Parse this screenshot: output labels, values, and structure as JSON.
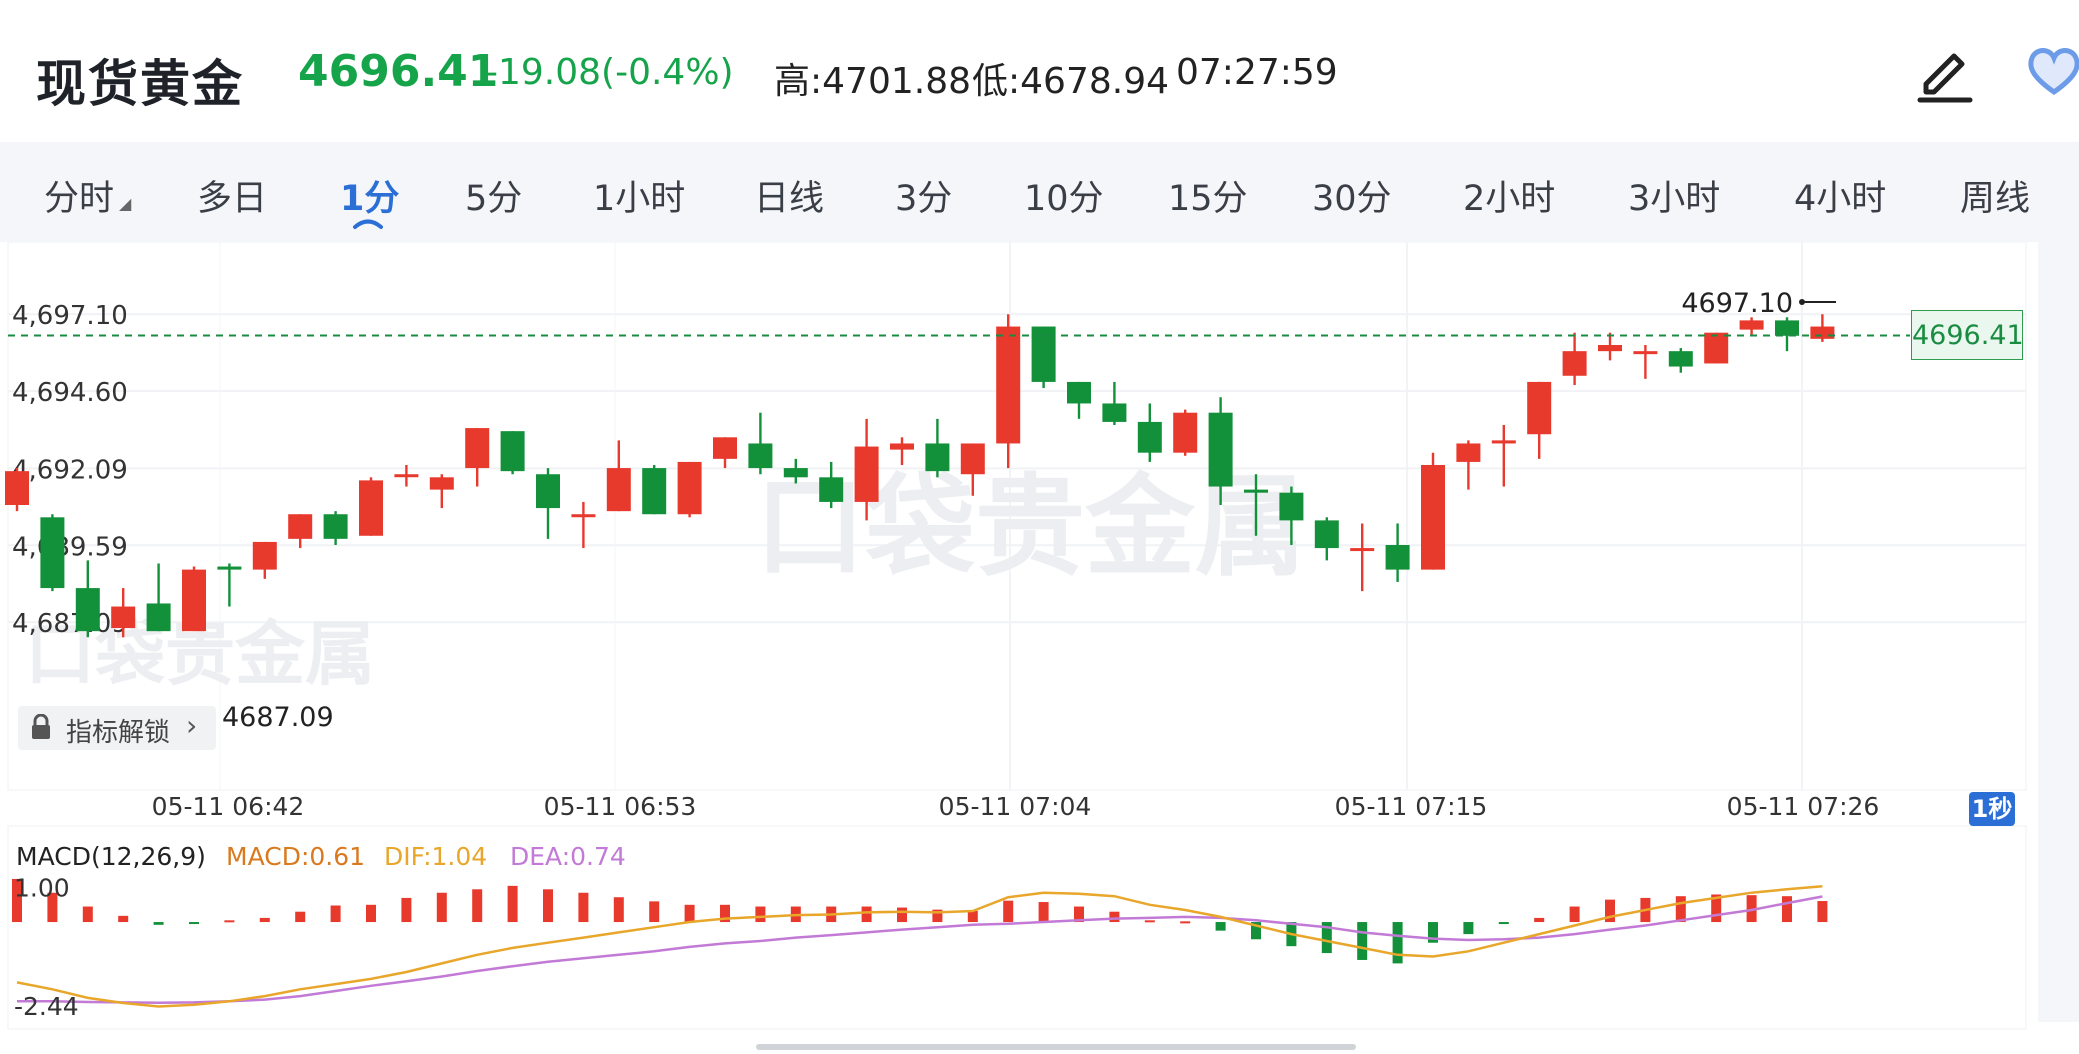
{
  "header": {
    "title": "现货黄金",
    "price": "4696.41",
    "change": "-19.08(-0.4%)",
    "high": "高:4701.88",
    "low": "低:4678.94",
    "time": "07:27:59"
  },
  "tabs": [
    "分时",
    "多日",
    "1分",
    "5分",
    "1小时",
    "日线",
    "3分",
    "10分",
    "15分",
    "30分",
    "2小时",
    "3小时",
    "4小时",
    "周线"
  ],
  "active_tab": "1分",
  "unlock_label": "指标解锁",
  "last_price_tag": "4696.41",
  "interval_badge": "1秒",
  "watermark": "口袋贵金属",
  "colors": {
    "up": "#e8392d",
    "down": "#13913a",
    "dif": "#e8a62a",
    "dea": "#c27ad6",
    "macd_label": "#d97a1e",
    "accent": "#2b6fd6"
  },
  "icons": {
    "edit": "pencil-icon",
    "favorite": "heart-icon",
    "lock": "lock-icon",
    "chevron": "chevron-right-icon"
  },
  "chart_data": {
    "type": "candlestick",
    "price_axis": {
      "ticks": [
        "4,697.10",
        "4,694.60",
        "4,692.09",
        "4,689.59",
        "4,687.09"
      ],
      "ylim": [
        4685.7,
        4698.7
      ]
    },
    "time_axis": [
      "05-11 06:42",
      "05-11 06:53",
      "05-11 07:04",
      "05-11 07:15",
      "05-11 07:26"
    ],
    "last_price": 4696.41,
    "max_label": "4697.10",
    "min_label": "4687.09",
    "candles": [
      {
        "o": 4690.9,
        "h": 4692.1,
        "l": 4690.7,
        "c": 4692.0
      },
      {
        "o": 4690.5,
        "h": 4690.6,
        "l": 4688.1,
        "c": 4688.2
      },
      {
        "o": 4688.2,
        "h": 4689.1,
        "l": 4686.6,
        "c": 4686.8
      },
      {
        "o": 4686.9,
        "h": 4688.2,
        "l": 4686.6,
        "c": 4687.6
      },
      {
        "o": 4687.7,
        "h": 4689.0,
        "l": 4686.8,
        "c": 4686.8
      },
      {
        "o": 4686.8,
        "h": 4688.9,
        "l": 4686.8,
        "c": 4688.8
      },
      {
        "o": 4688.9,
        "h": 4689.0,
        "l": 4687.6,
        "c": 4688.8
      },
      {
        "o": 4688.8,
        "h": 4689.7,
        "l": 4688.5,
        "c": 4689.7
      },
      {
        "o": 4689.8,
        "h": 4690.6,
        "l": 4689.5,
        "c": 4690.6
      },
      {
        "o": 4690.6,
        "h": 4690.7,
        "l": 4689.6,
        "c": 4689.8
      },
      {
        "o": 4689.9,
        "h": 4691.8,
        "l": 4689.9,
        "c": 4691.7
      },
      {
        "o": 4691.9,
        "h": 4692.2,
        "l": 4691.5,
        "c": 4691.9
      },
      {
        "o": 4691.4,
        "h": 4691.9,
        "l": 4690.8,
        "c": 4691.8
      },
      {
        "o": 4692.1,
        "h": 4693.4,
        "l": 4691.5,
        "c": 4693.4
      },
      {
        "o": 4693.3,
        "h": 4693.3,
        "l": 4691.9,
        "c": 4692.0
      },
      {
        "o": 4691.9,
        "h": 4692.1,
        "l": 4689.8,
        "c": 4690.8
      },
      {
        "o": 4690.6,
        "h": 4691.0,
        "l": 4689.5,
        "c": 4690.6
      },
      {
        "o": 4690.7,
        "h": 4693.0,
        "l": 4690.7,
        "c": 4692.1
      },
      {
        "o": 4692.1,
        "h": 4692.2,
        "l": 4690.6,
        "c": 4690.6
      },
      {
        "o": 4690.6,
        "h": 4692.3,
        "l": 4690.5,
        "c": 4692.3
      },
      {
        "o": 4692.4,
        "h": 4693.1,
        "l": 4692.1,
        "c": 4693.1
      },
      {
        "o": 4692.9,
        "h": 4693.9,
        "l": 4691.9,
        "c": 4692.1
      },
      {
        "o": 4692.1,
        "h": 4692.4,
        "l": 4691.6,
        "c": 4691.8
      },
      {
        "o": 4691.8,
        "h": 4692.3,
        "l": 4690.8,
        "c": 4691.0
      },
      {
        "o": 4691.0,
        "h": 4693.7,
        "l": 4690.4,
        "c": 4692.8
      },
      {
        "o": 4692.7,
        "h": 4693.1,
        "l": 4692.2,
        "c": 4692.9
      },
      {
        "o": 4692.9,
        "h": 4693.7,
        "l": 4691.8,
        "c": 4692.0
      },
      {
        "o": 4691.9,
        "h": 4692.9,
        "l": 4691.2,
        "c": 4692.9
      },
      {
        "o": 4692.9,
        "h": 4697.1,
        "l": 4692.1,
        "c": 4696.7
      },
      {
        "o": 4696.7,
        "h": 4696.7,
        "l": 4694.7,
        "c": 4694.9
      },
      {
        "o": 4694.9,
        "h": 4694.9,
        "l": 4693.7,
        "c": 4694.2
      },
      {
        "o": 4694.2,
        "h": 4694.9,
        "l": 4693.5,
        "c": 4693.6
      },
      {
        "o": 4693.6,
        "h": 4694.2,
        "l": 4692.3,
        "c": 4692.6
      },
      {
        "o": 4692.6,
        "h": 4694.0,
        "l": 4692.5,
        "c": 4693.9
      },
      {
        "o": 4693.9,
        "h": 4694.4,
        "l": 4690.9,
        "c": 4691.5
      },
      {
        "o": 4691.4,
        "h": 4691.9,
        "l": 4689.9,
        "c": 4691.3
      },
      {
        "o": 4691.3,
        "h": 4691.5,
        "l": 4689.6,
        "c": 4690.4
      },
      {
        "o": 4690.4,
        "h": 4690.5,
        "l": 4689.1,
        "c": 4689.5
      },
      {
        "o": 4689.5,
        "h": 4690.3,
        "l": 4688.1,
        "c": 4689.5
      },
      {
        "o": 4689.6,
        "h": 4690.3,
        "l": 4688.4,
        "c": 4688.8
      },
      {
        "o": 4688.8,
        "h": 4692.6,
        "l": 4688.8,
        "c": 4692.2
      },
      {
        "o": 4692.3,
        "h": 4693.0,
        "l": 4691.4,
        "c": 4692.9
      },
      {
        "o": 4692.9,
        "h": 4693.5,
        "l": 4691.5,
        "c": 4693.0
      },
      {
        "o": 4693.2,
        "h": 4694.9,
        "l": 4692.4,
        "c": 4694.9
      },
      {
        "o": 4695.1,
        "h": 4696.5,
        "l": 4694.8,
        "c": 4695.9
      },
      {
        "o": 4695.9,
        "h": 4696.5,
        "l": 4695.6,
        "c": 4696.1
      },
      {
        "o": 4695.9,
        "h": 4696.1,
        "l": 4695.0,
        "c": 4695.9
      },
      {
        "o": 4695.9,
        "h": 4696.0,
        "l": 4695.2,
        "c": 4695.4
      },
      {
        "o": 4695.5,
        "h": 4696.5,
        "l": 4695.5,
        "c": 4696.5
      },
      {
        "o": 4696.6,
        "h": 4697.0,
        "l": 4696.4,
        "c": 4696.9
      },
      {
        "o": 4696.9,
        "h": 4697.0,
        "l": 4695.9,
        "c": 4696.4
      },
      {
        "o": 4696.3,
        "h": 4697.1,
        "l": 4696.2,
        "c": 4696.7
      }
    ],
    "macd": {
      "title": "MACD(12,26,9)",
      "macd_label": "MACD:0.61",
      "dif_label": "DIF:1.04",
      "dea_label": "DEA:0.74",
      "ticks": [
        "1.00",
        "-2.44"
      ],
      "ylim": [
        -2.9,
        1.8
      ],
      "hist": [
        1.25,
        0.85,
        0.45,
        0.18,
        -0.08,
        -0.05,
        0.05,
        0.12,
        0.3,
        0.48,
        0.5,
        0.7,
        0.85,
        0.95,
        1.05,
        0.95,
        0.85,
        0.72,
        0.6,
        0.5,
        0.5,
        0.45,
        0.45,
        0.45,
        0.45,
        0.42,
        0.36,
        0.32,
        0.62,
        0.58,
        0.45,
        0.3,
        0.05,
        0.02,
        -0.25,
        -0.5,
        -0.7,
        -0.9,
        -1.1,
        -1.2,
        -0.6,
        -0.35,
        -0.05,
        0.12,
        0.45,
        0.65,
        0.7,
        0.75,
        0.8,
        0.78,
        0.75,
        0.61
      ],
      "dif": [
        -1.75,
        -1.95,
        -2.2,
        -2.35,
        -2.45,
        -2.4,
        -2.3,
        -2.15,
        -1.95,
        -1.8,
        -1.65,
        -1.45,
        -1.2,
        -0.95,
        -0.75,
        -0.6,
        -0.45,
        -0.3,
        -0.15,
        0.0,
        0.1,
        0.15,
        0.2,
        0.22,
        0.28,
        0.3,
        0.28,
        0.32,
        0.72,
        0.85,
        0.82,
        0.75,
        0.5,
        0.35,
        0.15,
        -0.1,
        -0.35,
        -0.55,
        -0.75,
        -0.95,
        -1.0,
        -0.85,
        -0.6,
        -0.35,
        -0.1,
        0.15,
        0.35,
        0.55,
        0.7,
        0.85,
        0.95,
        1.04
      ],
      "dea": [
        -2.3,
        -2.3,
        -2.32,
        -2.33,
        -2.34,
        -2.33,
        -2.3,
        -2.25,
        -2.15,
        -2.0,
        -1.85,
        -1.72,
        -1.58,
        -1.42,
        -1.28,
        -1.15,
        -1.05,
        -0.95,
        -0.85,
        -0.72,
        -0.62,
        -0.55,
        -0.45,
        -0.38,
        -0.3,
        -0.22,
        -0.15,
        -0.08,
        -0.05,
        0.0,
        0.05,
        0.1,
        0.12,
        0.15,
        0.12,
        0.05,
        -0.05,
        -0.15,
        -0.3,
        -0.4,
        -0.48,
        -0.52,
        -0.5,
        -0.45,
        -0.35,
        -0.22,
        -0.1,
        0.05,
        0.2,
        0.35,
        0.55,
        0.74
      ]
    }
  }
}
